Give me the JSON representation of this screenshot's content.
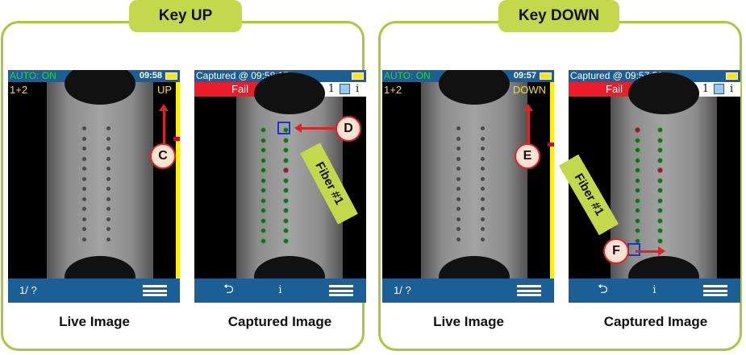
{
  "panels": [
    {
      "tab": "Key UP",
      "live": {
        "status": "AUTO: ON",
        "time": "09:58",
        "channel": "1+2",
        "mode": "UP",
        "page": "1/ ?",
        "caption": "Live Image",
        "callout": "C"
      },
      "captured": {
        "status": "Captured @ 09:58:17",
        "result": "Fail",
        "number": "1",
        "info": "i",
        "caption": "Captured Image",
        "callout": "D",
        "fiber_label": "Fiber #1"
      }
    },
    {
      "tab": "Key DOWN",
      "live": {
        "status": "AUTO: ON",
        "time": "09:57",
        "channel": "1+2",
        "mode": "DOWN",
        "page": "1/ ?",
        "caption": "Live Image",
        "callout": "E"
      },
      "captured": {
        "status": "Captured @ 09:57:58",
        "result": "Fail",
        "number": "1",
        "info": "i",
        "caption": "Captured Image",
        "callout": "F",
        "fiber_label": "Fiber #1"
      }
    }
  ],
  "colors": {
    "frame": "#a9c93a",
    "tab": "#c4d84c",
    "bar": "#1c5f96",
    "fail": "#ee1b2a",
    "pass_ring": "#25c525",
    "fail_ring": "#e0303a",
    "callout": "#e02226",
    "indicator": "#ffef00"
  },
  "icons": [
    "battery-icon",
    "grid-icon",
    "info-icon",
    "back-icon",
    "menu-icon"
  ]
}
